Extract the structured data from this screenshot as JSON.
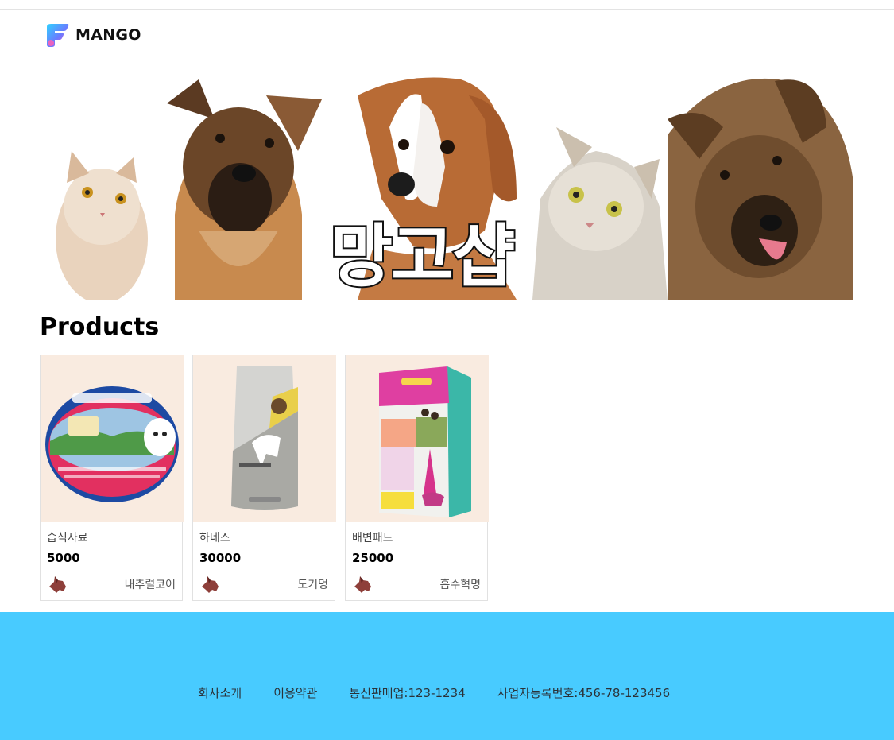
{
  "header": {
    "logo_text": "MANGO"
  },
  "banner": {
    "title": "망고샵"
  },
  "main": {
    "section_title": "Products",
    "products": [
      {
        "name": "습식사료",
        "price": "5000",
        "seller": "내추럴코어",
        "image_icon": "wet-food-can-icon"
      },
      {
        "name": "하네스",
        "price": "30000",
        "seller": "도기멍",
        "image_icon": "food-bag-icon"
      },
      {
        "name": "배변패드",
        "price": "25000",
        "seller": "흡수혁명",
        "image_icon": "pad-box-icon"
      }
    ]
  },
  "footer": {
    "links": [
      "회사소개",
      "이용약관",
      "통신판매업:123-1234",
      "사업자등록번호:456-78-123456"
    ]
  },
  "colors": {
    "footer_bg": "#48cbff",
    "card_image_bg": "#f9ebe0"
  }
}
